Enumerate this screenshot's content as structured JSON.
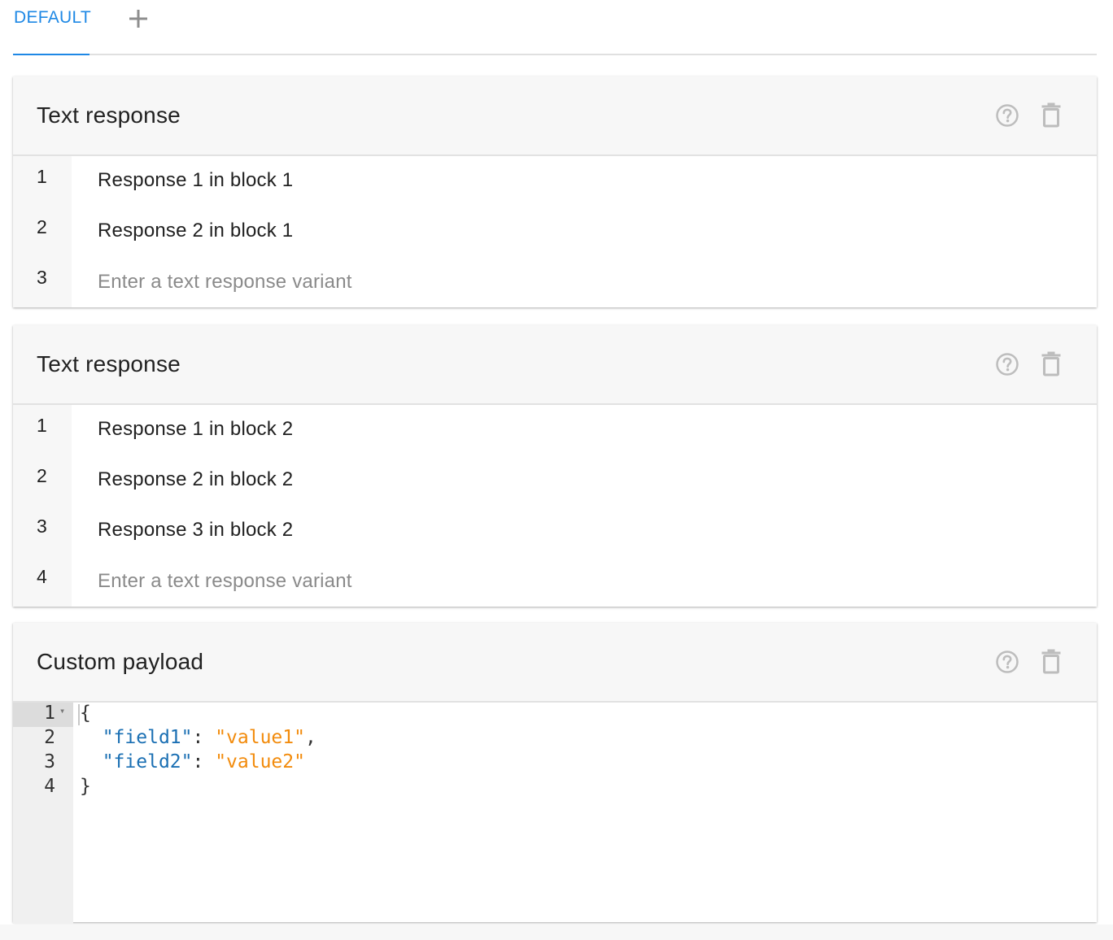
{
  "tabs": {
    "active_label": "DEFAULT",
    "add_icon": "plus-icon"
  },
  "colors": {
    "accent": "#1e88e5",
    "json_key": "#1a6fb3",
    "json_string": "#f28b0c",
    "header_bg": "#f7f7f7",
    "icon_gray": "#bdbdbd"
  },
  "blocks": [
    {
      "title": "Text response",
      "icons": [
        "help-icon",
        "delete-icon"
      ],
      "rows": [
        {
          "num": "1",
          "text": "Response 1 in block 1"
        },
        {
          "num": "2",
          "text": "Response 2 in block 1"
        }
      ],
      "input": {
        "num": "3",
        "placeholder": "Enter a text response variant",
        "value": ""
      }
    },
    {
      "title": "Text response",
      "icons": [
        "help-icon",
        "delete-icon"
      ],
      "rows": [
        {
          "num": "1",
          "text": "Response 1 in block 2"
        },
        {
          "num": "2",
          "text": "Response 2 in block 2"
        },
        {
          "num": "3",
          "text": "Response 3 in block 2"
        }
      ],
      "input": {
        "num": "4",
        "placeholder": "Enter a text response variant",
        "value": ""
      }
    }
  ],
  "payload": {
    "title": "Custom payload",
    "icons": [
      "help-icon",
      "delete-icon"
    ],
    "lines": [
      {
        "num": "1",
        "open": "{"
      },
      {
        "num": "2",
        "key": "\"field1\"",
        "colon": ": ",
        "value": "\"value1\"",
        "trail": ","
      },
      {
        "num": "3",
        "key": "\"field2\"",
        "colon": ": ",
        "value": "\"value2\"",
        "trail": ""
      },
      {
        "num": "4",
        "close": "}"
      }
    ]
  }
}
